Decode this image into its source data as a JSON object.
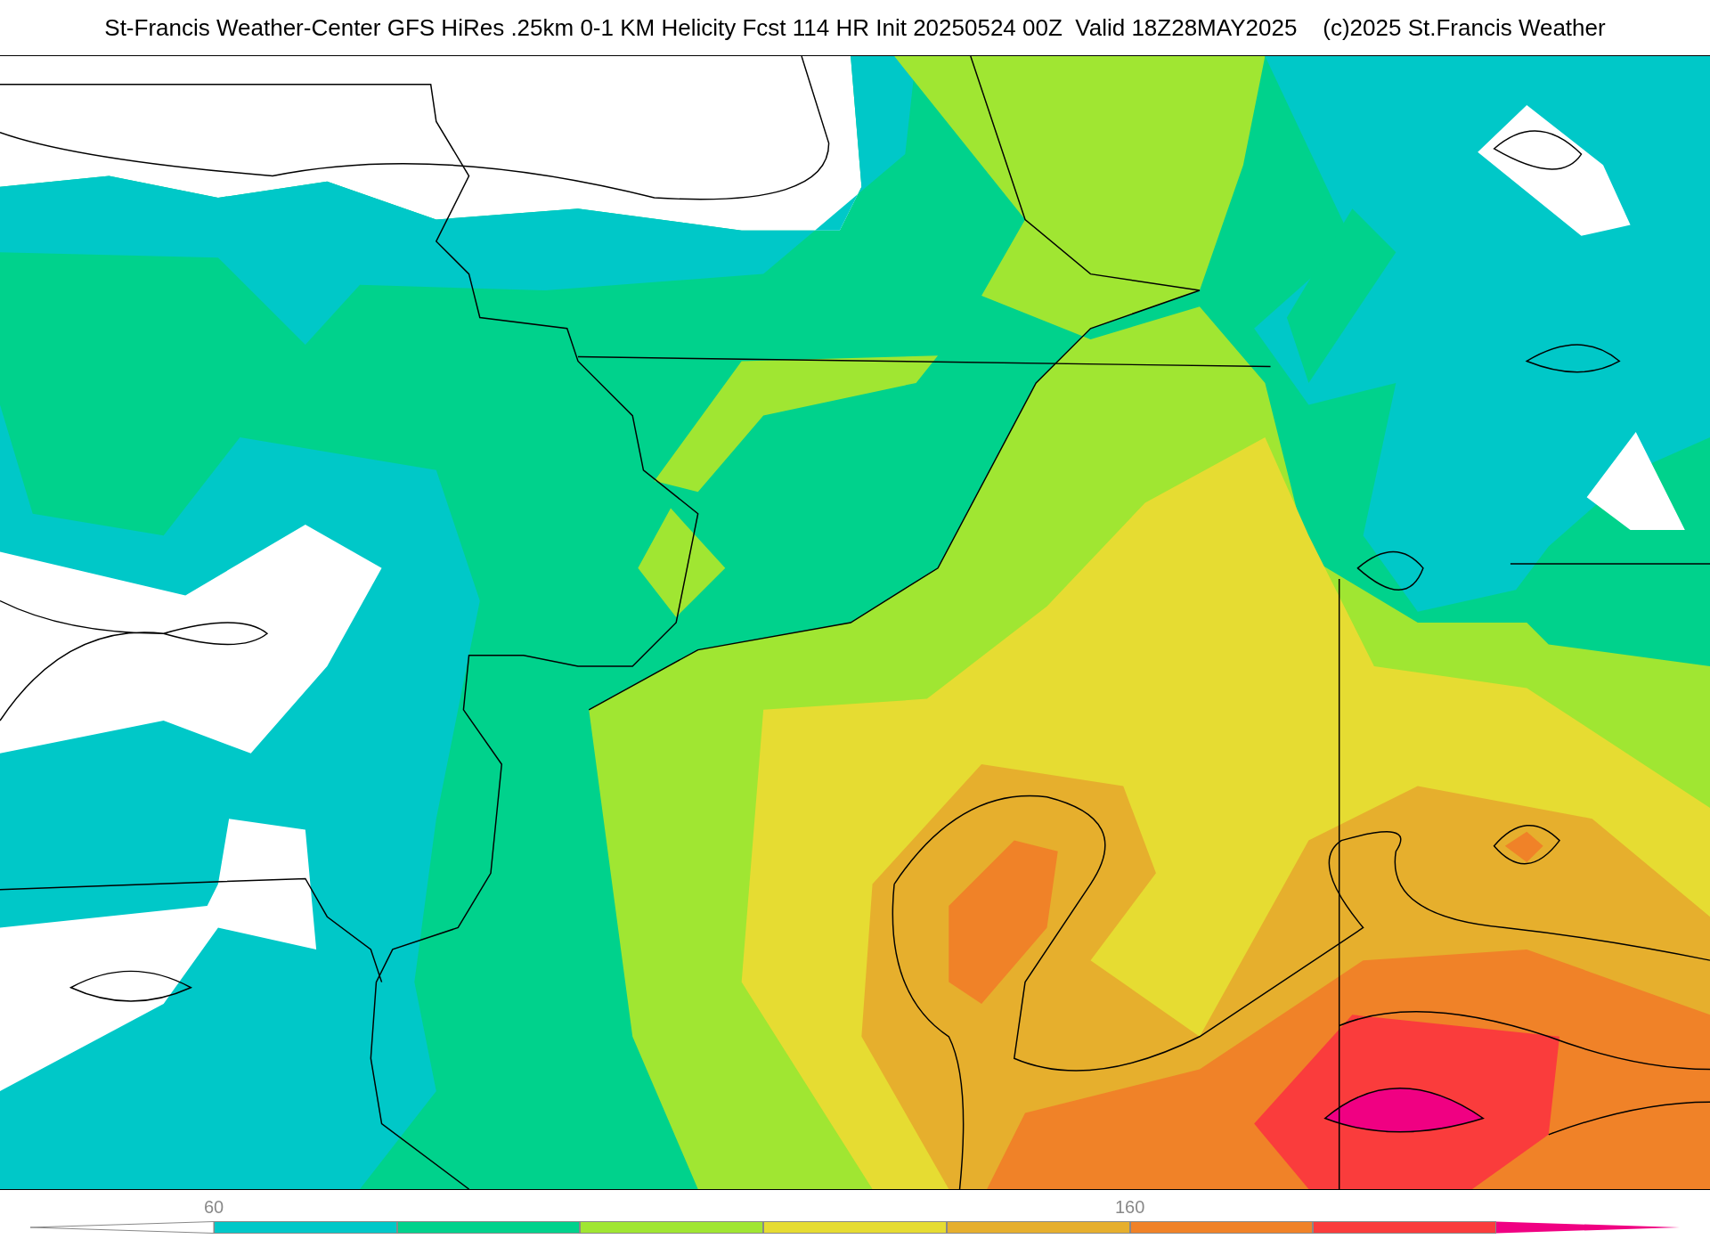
{
  "title": "St-Francis Weather-Center GFS HiRes .25km 0-1 KM Helicity Fcst 114 HR Init 20250524 00Z  Valid 18Z28MAY2025    (c)2025 St.Francis Weather",
  "colorbar": {
    "segments": [
      {
        "kind": "under",
        "color": "#ffffff"
      },
      {
        "kind": "box",
        "color": "#00c8c8",
        "label": "60"
      },
      {
        "kind": "box",
        "color": "#00d28c"
      },
      {
        "kind": "box",
        "color": "#a0e632"
      },
      {
        "kind": "box",
        "color": "#e6dc32"
      },
      {
        "kind": "box",
        "color": "#e6af2d"
      },
      {
        "kind": "box",
        "color": "#f08228",
        "label": "160"
      },
      {
        "kind": "box",
        "color": "#fa3c3c"
      },
      {
        "kind": "over",
        "color": "#f00082"
      }
    ]
  }
}
